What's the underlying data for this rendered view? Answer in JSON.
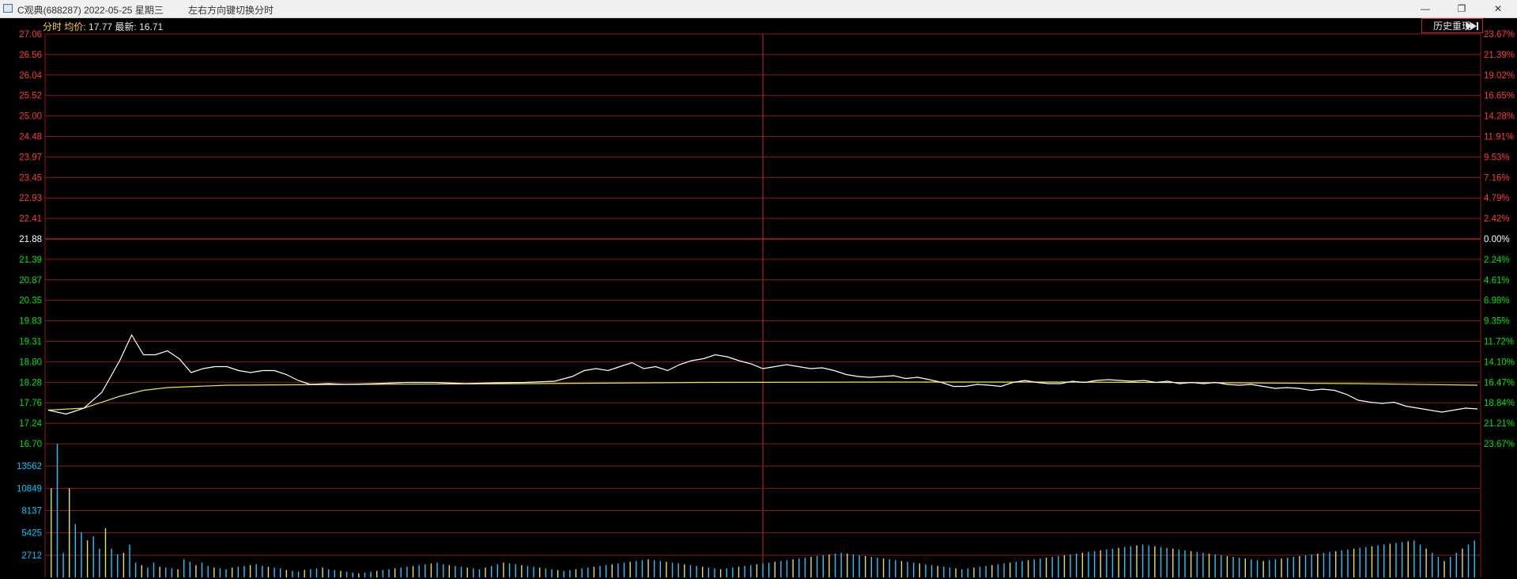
{
  "window": {
    "title": "C观典(688287) 2022-05-25 星期三",
    "hint": "左右方向键切换分时",
    "buttons": {
      "minimize": "—",
      "restore": "❐",
      "close": "✕"
    }
  },
  "header": {
    "label_fenshi": "分时",
    "label_avg": "均价:",
    "avg_value": "17.77",
    "label_latest": "最新:",
    "latest_value": "16.71",
    "history_button": "历史重现",
    "back_icon": "rewind-to-start-icon"
  },
  "colors": {
    "background": "#000000",
    "grid": "#8b1a1a",
    "up": "#ff3b3b",
    "down": "#00e600",
    "flat": "#ffffff",
    "price_line": "#ffffff",
    "avg_line": "#e6e64d",
    "volume_labels": "#00c8ff",
    "volume_up": "#e6e64d",
    "volume_down": "#22c8ff"
  },
  "chart_data": {
    "type": "line",
    "prev_close": 21.88,
    "price_axis_left": [
      "27.06",
      "26.56",
      "26.04",
      "25.52",
      "25.00",
      "24.48",
      "23.97",
      "23.45",
      "22.93",
      "22.41",
      "21.88",
      "21.39",
      "20.87",
      "20.35",
      "19.83",
      "19.31",
      "18.80",
      "18.28",
      "17.76",
      "17.24",
      "16.70"
    ],
    "percent_axis_right": [
      "23.67%",
      "21.39%",
      "19.02%",
      "16.65%",
      "14.28%",
      "11.91%",
      "9.53%",
      "7.16%",
      "4.79%",
      "2.42%",
      "0.00%",
      "2.24%",
      "4.61%",
      "6.98%",
      "9.35%",
      "11.72%",
      "14.10%",
      "16.47%",
      "18.84%",
      "21.21%",
      "23.67%"
    ],
    "price_ylim": [
      16.7,
      27.06
    ],
    "volume_axis_left": [
      "13562",
      "10849",
      "8137",
      "5425",
      "2712"
    ],
    "volume_ylim": [
      0,
      16275
    ],
    "price_series_x_range": [
      0,
      240
    ],
    "price_series": [
      [
        0,
        17.55
      ],
      [
        3,
        17.45
      ],
      [
        6,
        17.6
      ],
      [
        9,
        18.0
      ],
      [
        12,
        18.8
      ],
      [
        14,
        19.45
      ],
      [
        16,
        18.95
      ],
      [
        18,
        18.95
      ],
      [
        20,
        19.05
      ],
      [
        22,
        18.85
      ],
      [
        24,
        18.5
      ],
      [
        26,
        18.6
      ],
      [
        28,
        18.65
      ],
      [
        30,
        18.65
      ],
      [
        32,
        18.55
      ],
      [
        34,
        18.5
      ],
      [
        36,
        18.55
      ],
      [
        38,
        18.55
      ],
      [
        40,
        18.45
      ],
      [
        42,
        18.3
      ],
      [
        44,
        18.2
      ],
      [
        47,
        18.22
      ],
      [
        50,
        18.2
      ],
      [
        55,
        18.22
      ],
      [
        60,
        18.25
      ],
      [
        65,
        18.25
      ],
      [
        70,
        18.22
      ],
      [
        75,
        18.24
      ],
      [
        80,
        18.25
      ],
      [
        85,
        18.28
      ],
      [
        88,
        18.4
      ],
      [
        90,
        18.55
      ],
      [
        92,
        18.6
      ],
      [
        94,
        18.55
      ],
      [
        96,
        18.65
      ],
      [
        98,
        18.75
      ],
      [
        100,
        18.6
      ],
      [
        102,
        18.65
      ],
      [
        104,
        18.55
      ],
      [
        106,
        18.7
      ],
      [
        108,
        18.8
      ],
      [
        110,
        18.85
      ],
      [
        112,
        18.95
      ],
      [
        114,
        18.9
      ],
      [
        116,
        18.8
      ],
      [
        118,
        18.72
      ],
      [
        120,
        18.6
      ],
      [
        122,
        18.65
      ],
      [
        124,
        18.7
      ],
      [
        126,
        18.65
      ],
      [
        128,
        18.6
      ],
      [
        130,
        18.62
      ],
      [
        132,
        18.55
      ],
      [
        134,
        18.45
      ],
      [
        136,
        18.4
      ],
      [
        138,
        18.38
      ],
      [
        140,
        18.4
      ],
      [
        142,
        18.42
      ],
      [
        144,
        18.35
      ],
      [
        146,
        18.38
      ],
      [
        148,
        18.32
      ],
      [
        150,
        18.25
      ],
      [
        152,
        18.15
      ],
      [
        154,
        18.15
      ],
      [
        156,
        18.2
      ],
      [
        158,
        18.18
      ],
      [
        160,
        18.15
      ],
      [
        162,
        18.25
      ],
      [
        164,
        18.3
      ],
      [
        166,
        18.25
      ],
      [
        168,
        18.22
      ],
      [
        170,
        18.22
      ],
      [
        172,
        18.28
      ],
      [
        174,
        18.25
      ],
      [
        176,
        18.3
      ],
      [
        178,
        18.32
      ],
      [
        180,
        18.3
      ],
      [
        182,
        18.28
      ],
      [
        184,
        18.3
      ],
      [
        186,
        18.25
      ],
      [
        188,
        18.28
      ],
      [
        190,
        18.22
      ],
      [
        192,
        18.25
      ],
      [
        194,
        18.22
      ],
      [
        196,
        18.25
      ],
      [
        198,
        18.2
      ],
      [
        200,
        18.18
      ],
      [
        202,
        18.2
      ],
      [
        204,
        18.15
      ],
      [
        206,
        18.1
      ],
      [
        208,
        18.12
      ],
      [
        210,
        18.1
      ],
      [
        212,
        18.05
      ],
      [
        214,
        18.08
      ],
      [
        216,
        18.05
      ],
      [
        218,
        17.95
      ],
      [
        220,
        17.8
      ],
      [
        222,
        17.75
      ],
      [
        224,
        17.72
      ],
      [
        226,
        17.75
      ],
      [
        228,
        17.65
      ],
      [
        230,
        17.6
      ],
      [
        232,
        17.55
      ],
      [
        234,
        17.5
      ],
      [
        236,
        17.55
      ],
      [
        238,
        17.6
      ],
      [
        240,
        17.58
      ]
    ],
    "avg_series": [
      [
        0,
        17.55
      ],
      [
        6,
        17.6
      ],
      [
        12,
        17.9
      ],
      [
        16,
        18.05
      ],
      [
        20,
        18.12
      ],
      [
        30,
        18.18
      ],
      [
        50,
        18.2
      ],
      [
        80,
        18.22
      ],
      [
        110,
        18.25
      ],
      [
        140,
        18.26
      ],
      [
        170,
        18.26
      ],
      [
        200,
        18.24
      ],
      [
        220,
        18.22
      ],
      [
        240,
        18.18
      ]
    ],
    "volume_series": [
      10849,
      16275,
      3000,
      10849,
      6500,
      5500,
      4500,
      5000,
      3500,
      6000,
      3500,
      2800,
      3000,
      4000,
      1800,
      1500,
      1200,
      1800,
      1300,
      1200,
      1100,
      1000,
      2200,
      1900,
      1500,
      1800,
      1400,
      1200,
      1100,
      1000,
      1200,
      1300,
      1400,
      1500,
      1600,
      1400,
      1300,
      1200,
      1100,
      900,
      800,
      700,
      900,
      1000,
      1100,
      1200,
      1000,
      900,
      800,
      700,
      600,
      500,
      600,
      700,
      800,
      900,
      1000,
      1100,
      1200,
      1300,
      1400,
      1500,
      1600,
      1700,
      1800,
      1600,
      1500,
      1400,
      1300,
      1200,
      1100,
      1000,
      1200,
      1400,
      1600,
      1800,
      1700,
      1600,
      1500,
      1400,
      1300,
      1200,
      1100,
      1000,
      900,
      800,
      900,
      1000,
      1100,
      1200,
      1300,
      1400,
      1500,
      1600,
      1700,
      1800,
      1900,
      2000,
      2100,
      2200,
      2100,
      2000,
      1900,
      1800,
      1700,
      1600,
      1500,
      1400,
      1300,
      1200,
      1100,
      1000,
      1100,
      1200,
      1300,
      1400,
      1500,
      1600,
      1700,
      1800,
      1900,
      2000,
      2100,
      2200,
      2300,
      2400,
      2500,
      2600,
      2700,
      2800,
      2900,
      3000,
      2900,
      2800,
      2700,
      2600,
      2500,
      2400,
      2300,
      2200,
      2100,
      2000,
      1900,
      1800,
      1700,
      1600,
      1500,
      1400,
      1300,
      1200,
      1100,
      1000,
      1100,
      1200,
      1300,
      1400,
      1500,
      1600,
      1700,
      1800,
      1900,
      2000,
      2100,
      2200,
      2300,
      2400,
      2500,
      2600,
      2700,
      2800,
      2900,
      3000,
      3100,
      3200,
      3300,
      3400,
      3500,
      3600,
      3700,
      3800,
      3900,
      4000,
      3900,
      3800,
      3700,
      3600,
      3500,
      3400,
      3300,
      3200,
      3100,
      3000,
      2900,
      2800,
      2700,
      2600,
      2500,
      2400,
      2300,
      2200,
      2100,
      2000,
      2100,
      2200,
      2300,
      2400,
      2500,
      2600,
      2700,
      2800,
      2900,
      3000,
      3100,
      3200,
      3300,
      3400,
      3500,
      3600,
      3700,
      3800,
      3900,
      4000,
      4100,
      4200,
      4300,
      4400,
      4500,
      4000,
      3500,
      3000,
      2500,
      2000,
      2500,
      3000,
      3500,
      4000,
      4500
    ]
  }
}
